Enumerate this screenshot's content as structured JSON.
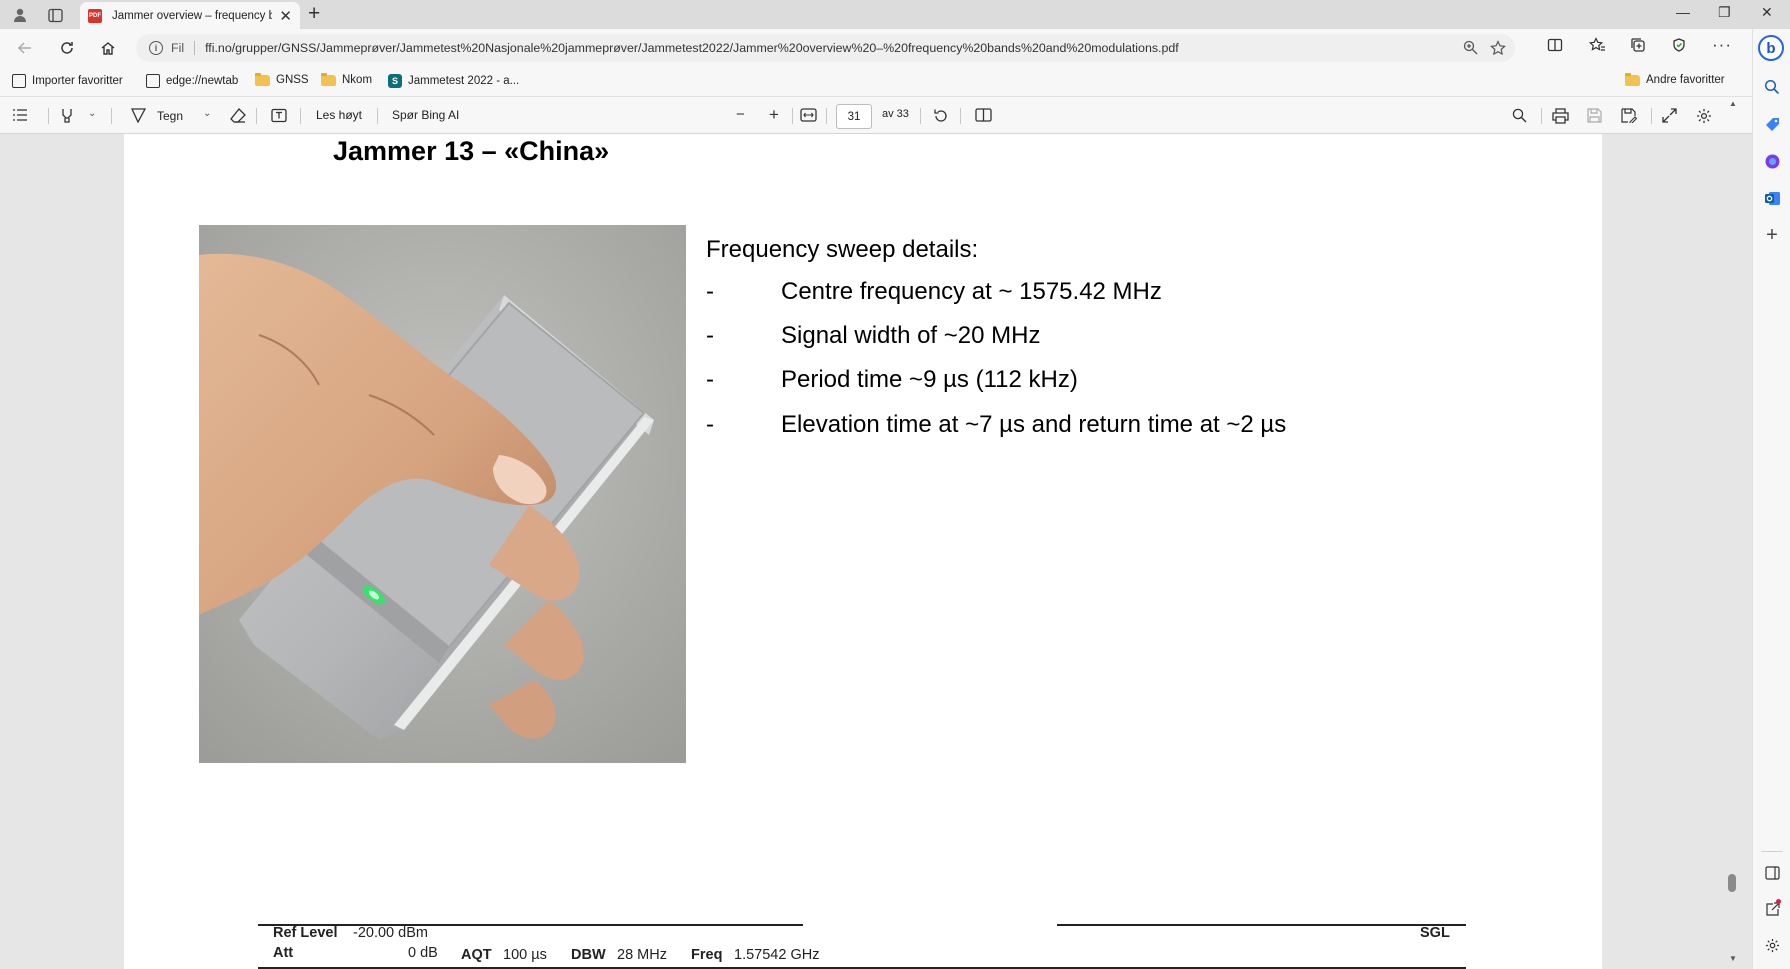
{
  "browser": {
    "tab_title": "Jammer overview – frequency bands and modulations.pdf",
    "tab_favicon_text": "PDF",
    "new_tab_symbol": "+",
    "close_tab_symbol": "✕",
    "address": {
      "scheme_label": "Fil",
      "url": "ffi.no/grupper/GNSS/Jammeprøver/Jammetest%20Nasjonale%20jammeprøver/Jammetest2022/Jammer%20overview%20–%20frequency%20bands%20and%20modulations.pdf"
    },
    "favorites": [
      {
        "label": "Importer favoritter",
        "icon": "import-icon"
      },
      {
        "label": "edge://newtab",
        "icon": "page-icon"
      },
      {
        "label": "GNSS",
        "icon": "folder-icon"
      },
      {
        "label": "Nkom",
        "icon": "folder-icon"
      },
      {
        "label": "Jammetest 2022 - a...",
        "icon": "sharepoint-icon"
      }
    ],
    "other_favorites": "Andre favoritter"
  },
  "pdf_toolbar": {
    "draw_label": "Tegn",
    "read_aloud_label": "Les høyt",
    "ask_bing_label": "Spør Bing AI",
    "current_page": "31",
    "page_total_label": "av 33"
  },
  "slide": {
    "title": "Jammer 13 – «China»",
    "details_heading": "Frequency sweep details:",
    "bullets": [
      {
        "dash": "-",
        "text": "Centre frequency at ~ 1575.42 MHz"
      },
      {
        "dash": "-",
        "text": "Signal width of ~20 MHz"
      },
      {
        "dash": "-",
        "text": "Period time ~9 µs (112 kHz)"
      },
      {
        "dash": "-",
        "text": "Elevation time at ~7 µs and return time at ~2 µs"
      }
    ],
    "spectrum_header": {
      "ref_level_label": "Ref Level",
      "ref_level_value": "-20.00 dBm",
      "att_label": "Att",
      "att_value": "0 dB",
      "aqt_label": "AQT",
      "aqt_value": "100 µs",
      "dbw_label": "DBW",
      "dbw_value": "28 MHz",
      "freq_label": "Freq",
      "freq_value": "1.57542 GHz",
      "mode": "SGL"
    }
  },
  "colors": {
    "tab_strip": "#dcdcdc",
    "toolbar": "#f7f7f7",
    "viewer_bg": "#e6e6e6",
    "pdf_favicon": "#d6342c",
    "led_green": "#35e36a"
  }
}
